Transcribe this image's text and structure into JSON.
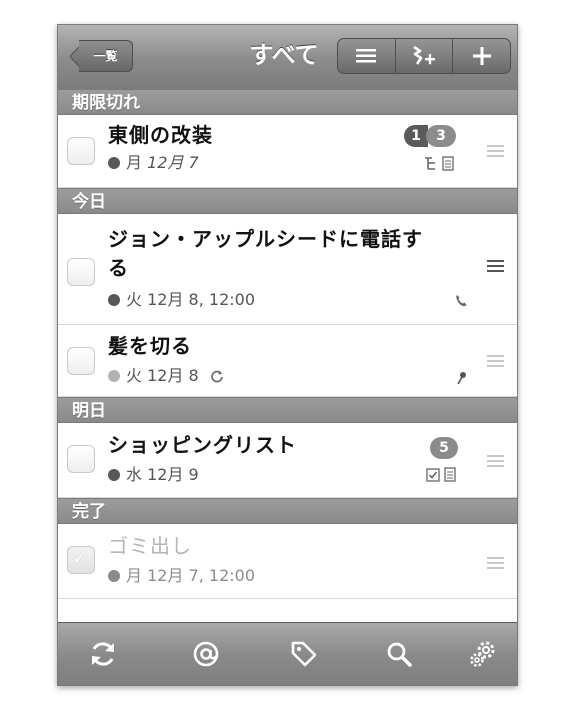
{
  "nav": {
    "back_label": "一覧",
    "title": "すべて",
    "segments": [
      {
        "icon": "list-icon",
        "glyph": "≡"
      },
      {
        "icon": "subtask-add-icon",
        "glyph": "⤵+"
      },
      {
        "icon": "add-icon",
        "glyph": "+"
      }
    ]
  },
  "sections": {
    "overdue": "期限切れ",
    "today": "今日",
    "tomorrow": "明日",
    "completed": "完了"
  },
  "tasks": {
    "t1": {
      "title": "東側の改装",
      "date_day": "月",
      "date_rest": "12月 7",
      "badge_left": "1",
      "badge_right": "3"
    },
    "t2": {
      "title_line1": "ジョン・アップルシードに電話す",
      "title_line2": "る",
      "date": "火 12月 8, 12:00"
    },
    "t3": {
      "title": "髪を切る",
      "date": "火 12月 8"
    },
    "t4": {
      "title": "ショッピングリスト",
      "date": "水 12月 9",
      "badge": "5"
    },
    "t5": {
      "title": "ゴミ出し",
      "date": "月 12月 7, 12:00"
    }
  },
  "toolbar": {
    "icons": [
      "sync-icon",
      "at-icon",
      "tag-icon",
      "search-icon",
      "settings-icon"
    ]
  }
}
